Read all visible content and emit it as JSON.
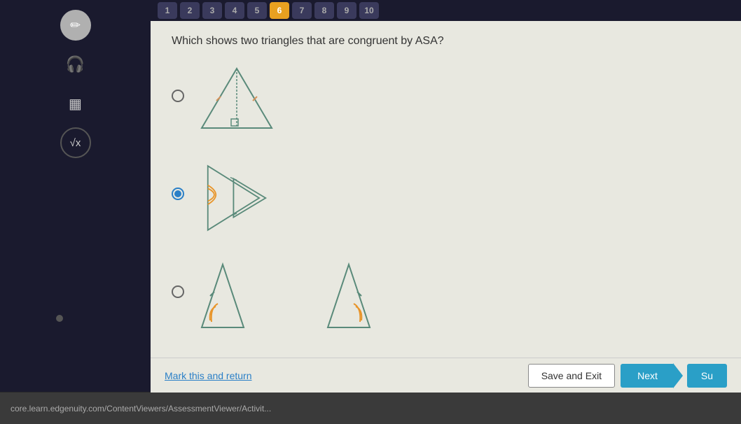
{
  "tabs": {
    "numbers": [
      1,
      2,
      3,
      4,
      5,
      6,
      7,
      8,
      9,
      10
    ],
    "active": 6
  },
  "toolbar": {
    "pencil_icon": "✏",
    "headphone_icon": "🎧",
    "calc_icon": "▦",
    "formula_icon": "√x"
  },
  "question": {
    "text": "Which shows two triangles that are congruent by ASA?"
  },
  "options": [
    {
      "id": "A",
      "selected": false
    },
    {
      "id": "B",
      "selected": true
    },
    {
      "id": "C",
      "selected": false
    }
  ],
  "buttons": {
    "mark_return": "Mark this and return",
    "save_exit": "Save and Exit",
    "next": "Next",
    "submit": "Su"
  },
  "url": "core.learn.edgenuity.com/ContentViewers/AssessmentViewer/Activit..."
}
